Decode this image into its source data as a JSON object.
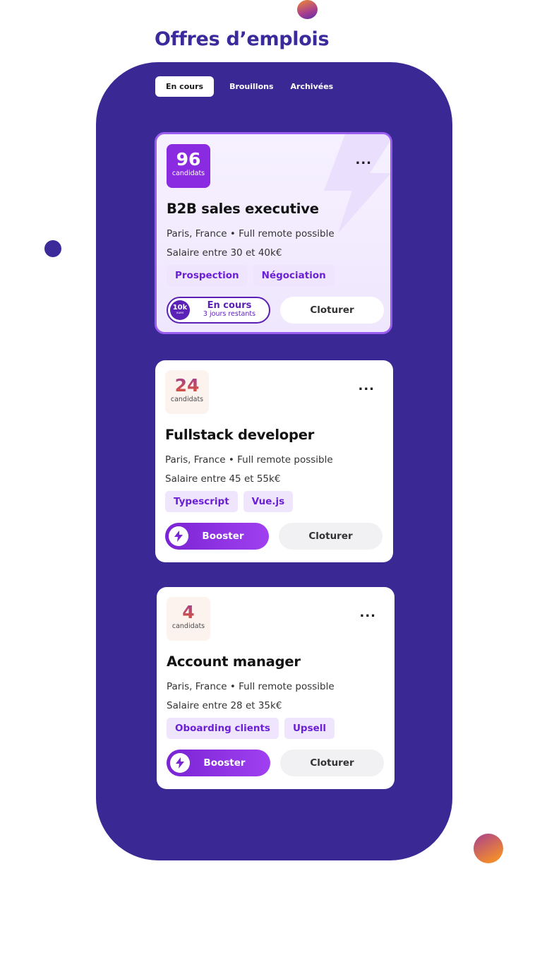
{
  "page": {
    "title": "Offres d’emplois"
  },
  "tabs": [
    {
      "label": "En cours",
      "active": true
    },
    {
      "label": "Brouillons",
      "active": false
    },
    {
      "label": "Archivées",
      "active": false
    }
  ],
  "jobs": [
    {
      "candidates": "96",
      "candidates_label": "candidats",
      "title": "B2B sales executive",
      "location": "Paris, France • Full remote possible",
      "salary": "Salaire entre 30 et 40k€",
      "tags": [
        "Prospection",
        "Négociation"
      ],
      "status": {
        "views": "10k",
        "views_label": "vues",
        "label": "En cours",
        "sublabel": "3 jours restants"
      },
      "close_label": "Cloturer",
      "more_label": "...",
      "highlighted": true
    },
    {
      "candidates": "24",
      "candidates_label": "candidats",
      "title": "Fullstack developer",
      "location": "Paris, France • Full remote possible",
      "salary": "Salaire entre 45 et 55k€",
      "tags": [
        "Typescript",
        "Vue.js"
      ],
      "booster_label": "Booster",
      "close_label": "Cloturer",
      "more_label": "...",
      "highlighted": false
    },
    {
      "candidates": "4",
      "candidates_label": "candidats",
      "title": "Account manager",
      "location": "Paris, France • Full remote possible",
      "salary": "Salaire entre 28 et 35k€",
      "tags": [
        "Oboarding clients",
        "Upsell"
      ],
      "booster_label": "Booster",
      "close_label": "Cloturer",
      "more_label": "...",
      "highlighted": false
    }
  ],
  "colors": {
    "brand": "#3a2895",
    "accent": "#8a2be2",
    "title": "#3a2a9c"
  },
  "icons": {
    "booster": "lightning-bolt-icon",
    "more": "more-dots-icon"
  }
}
